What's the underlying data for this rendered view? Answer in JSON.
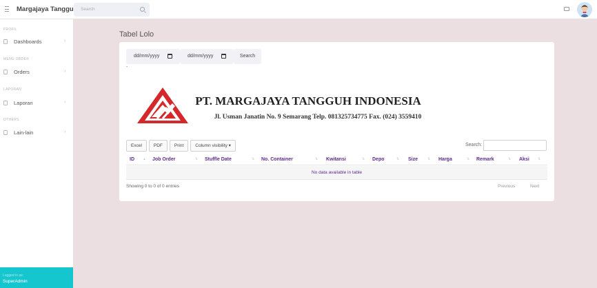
{
  "app": {
    "brand": "Margajaya Tangguh"
  },
  "topbar": {
    "search_placeholder": "Search"
  },
  "sidebar": {
    "sections": [
      {
        "heading": "PROFIL",
        "items": [
          {
            "label": "Dashboards"
          }
        ]
      },
      {
        "heading": "MENU ORDER",
        "items": [
          {
            "label": "Orders"
          }
        ]
      },
      {
        "heading": "LAPORAN",
        "items": [
          {
            "label": "Laporan"
          }
        ]
      },
      {
        "heading": "OTHERS",
        "items": [
          {
            "label": "Lain-lain"
          }
        ]
      }
    ],
    "footer": {
      "logged_in_as": "Logged in as:",
      "user": "SuperAdmin"
    }
  },
  "page": {
    "title": "Tabel Lolo"
  },
  "filters": {
    "date_from": "dd/mm/yyyy",
    "date_to": "dd/mm/yyyy",
    "search_button": "Search",
    "separator": "-"
  },
  "header": {
    "company": "PT. MARGAJAYA TANGGUH INDONESIA",
    "address": "Jl. Usman Janatin No. 9 Semarang Telp. 081325734775 Fax. (024) 3559410"
  },
  "table": {
    "buttons": [
      "Excel",
      "PDF",
      "Print",
      "Column visibility ▾"
    ],
    "search_label": "Search:",
    "columns": [
      "ID",
      "Job Order",
      "Stuffle Date",
      "No. Container",
      "Kwitansi",
      "Depo",
      "Size",
      "Harga",
      "Remark",
      "Aksi"
    ],
    "empty_message": "No data available in table",
    "info": "Showing 0 to 0 of 0 entries",
    "pagination": {
      "previous": "Previous",
      "next": "Next"
    }
  },
  "colors": {
    "accent": "#5d2a8f",
    "sidebar_footer": "#16c6cf",
    "background": "#ecdfe1",
    "logo_red": "#d4282b"
  },
  "icons": [
    "menu-icon",
    "search-icon",
    "mail-icon",
    "avatar",
    "calendar-icon",
    "folder-icon",
    "chevron-right-icon",
    "sort-icon"
  ]
}
